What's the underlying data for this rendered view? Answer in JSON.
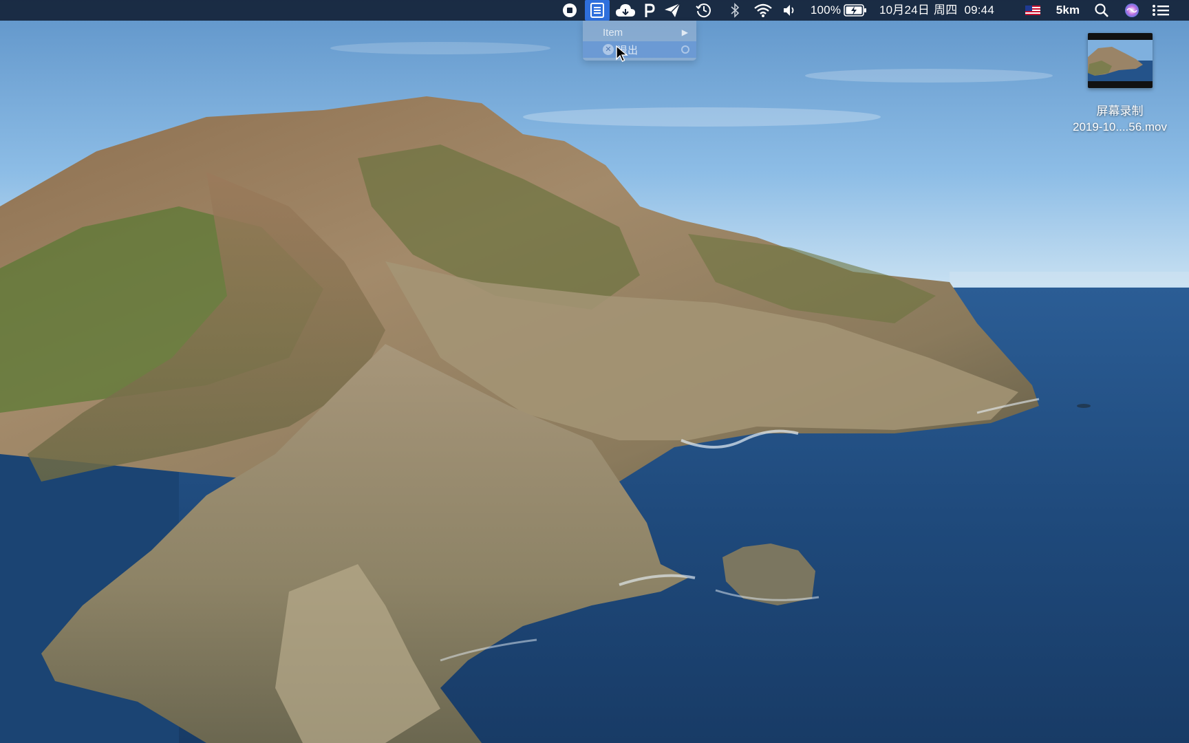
{
  "menubar": {
    "icons": [
      "screen-recording-stop-icon",
      "notes-list-icon",
      "cloud-icon",
      "parking-p-icon",
      "paper-plane-icon",
      "time-machine-icon",
      "bluetooth-icon",
      "wifi-icon",
      "volume-icon",
      "battery-charging-icon",
      "us-flag-input-icon",
      "spotlight-search-icon",
      "siri-icon",
      "notification-center-icon"
    ],
    "battery_percent": "100%",
    "battery_level": 1.0,
    "date": "10月24日",
    "weekday": "周四",
    "time": "09:44",
    "distance_label": "5km"
  },
  "dropdown": {
    "item_label": "Item",
    "quit_label": "退出"
  },
  "desktop_file": {
    "name_line1": "屏幕录制",
    "name_line2": "2019-10....56.mov"
  },
  "colors": {
    "menubar_bg": "#14233a",
    "active_highlight": "#2f6fdc",
    "sea": "#1f4a7c",
    "sky": "#7fb0de"
  }
}
